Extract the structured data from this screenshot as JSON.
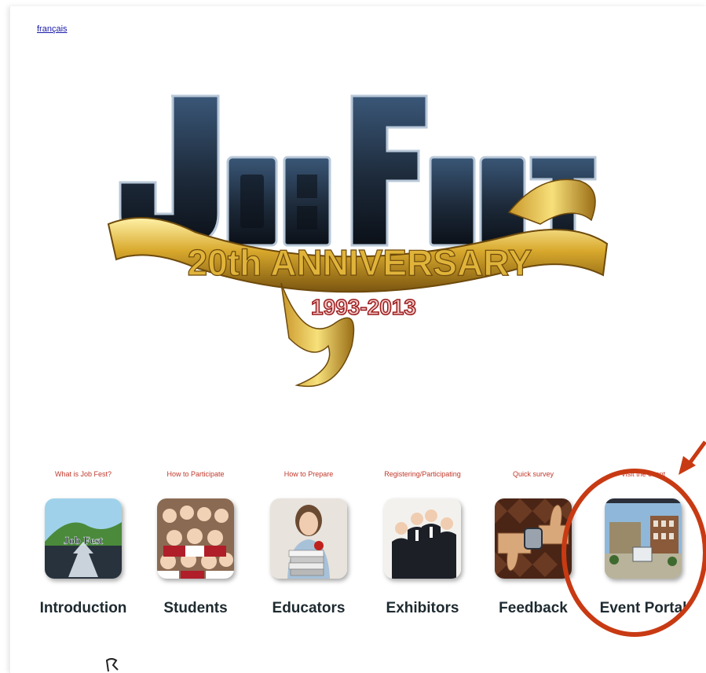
{
  "header": {
    "language_link": "français"
  },
  "logo": {
    "wordmark": "JOB FEST",
    "banner_text": "20th ANNIVERSARY",
    "years": "1993-2013"
  },
  "nav": [
    {
      "caption": "What is Job Fest?",
      "label": "Introduction",
      "icon": "road-arrows-icon"
    },
    {
      "caption": "How to Participate",
      "label": "Students",
      "icon": "students-crowd-icon"
    },
    {
      "caption": "How to Prepare",
      "label": "Educators",
      "icon": "educator-books-icon"
    },
    {
      "caption": "Registering/Participating",
      "label": "Exhibitors",
      "icon": "business-people-icon"
    },
    {
      "caption": "Quick survey",
      "label": "Feedback",
      "icon": "thumbs-icon"
    },
    {
      "caption": "Visit the event",
      "label": "Event Portal",
      "icon": "campus-building-icon"
    }
  ],
  "annotation": {
    "color": "#c83a13"
  }
}
